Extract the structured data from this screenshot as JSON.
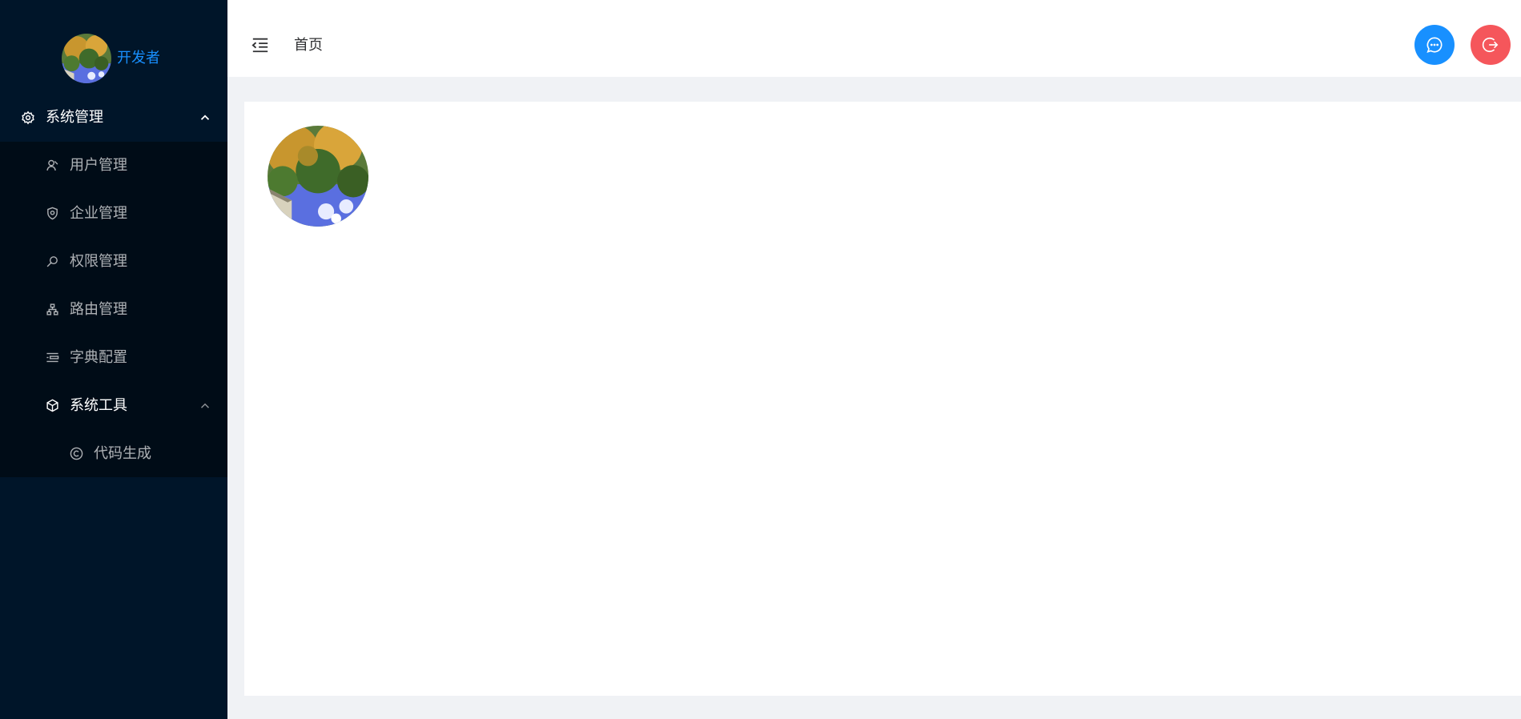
{
  "sidebar": {
    "profile": {
      "username": "开发者"
    },
    "group": {
      "label": "系统管理",
      "icon": "gear-icon",
      "expanded": true,
      "items": [
        {
          "label": "用户管理",
          "icon": "user-icon"
        },
        {
          "label": "企业管理",
          "icon": "shield-icon"
        },
        {
          "label": "权限管理",
          "icon": "search-icon"
        },
        {
          "label": "路由管理",
          "icon": "sitemap-icon"
        },
        {
          "label": "字典配置",
          "icon": "list-icon"
        }
      ],
      "subgroup": {
        "label": "系统工具",
        "icon": "cube-icon",
        "expanded": true,
        "items": [
          {
            "label": "代码生成",
            "icon": "copyright-icon"
          }
        ]
      }
    }
  },
  "header": {
    "fold_icon": "menu-fold-icon",
    "breadcrumb": "首页",
    "message_icon": "chat-bubble-icon",
    "logout_icon": "logout-icon"
  },
  "colors": {
    "sidebar_bg": "#001529",
    "submenu_bg": "#000c17",
    "accent_blue": "#1890ff",
    "logout_red": "#f5565b",
    "page_bg": "#f0f2f5"
  }
}
